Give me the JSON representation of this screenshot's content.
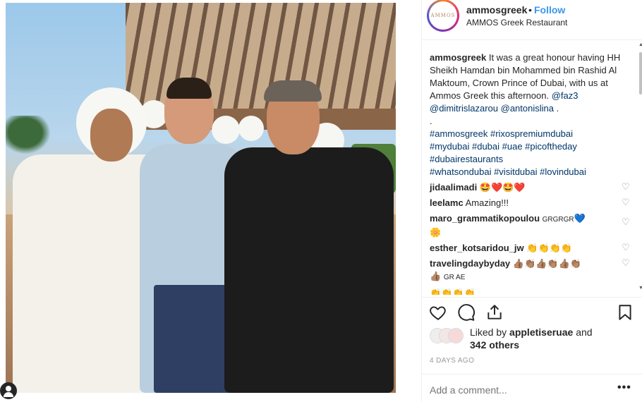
{
  "post": {
    "photo_alt": "Four men posing at a restaurant terrace"
  },
  "header": {
    "username": "ammosgreek",
    "separator": "•",
    "follow_label": "Follow",
    "location": "AMMOS Greek Restaurant",
    "logo_text": "AMMOS"
  },
  "caption": {
    "username": "ammosgreek",
    "text": "It was a great honour having HH Sheikh Hamdan bin Mohammed bin Rashid Al Maktoum, Crown Prince of Dubai, with us at Ammos Greek this afternoon.",
    "mentions": [
      "@faz3",
      "@dimitrislazarou",
      "@antonislina"
    ],
    "mention_end": " .",
    "dot_line": ".",
    "hashtags_line1": "#ammosgreek #rixospremiumdubai",
    "hashtags_line2": "#mydubai #dubai #uae #picoftheday",
    "hashtags_line3": "#dubairestaurants",
    "hashtags_line4": "#whatsondubai #visitdubai #lovindubai"
  },
  "comments": [
    {
      "user": "jidaalimadi",
      "text": "🤩❤️🤩❤️"
    },
    {
      "user": "leelamc",
      "text": "Amazing!!!"
    },
    {
      "user": "maro_grammatikopoulou",
      "text_small": "GRGRGR",
      "text": "💙",
      "line2": "🌼"
    },
    {
      "user": "esther_kotsaridou_jw",
      "text": "👏👏👏👏"
    },
    {
      "user": "travelingdaybyday",
      "text": "👍🏽👏🏽👍🏽👏🏽👍🏽👏🏽",
      "line2": "👍🏽",
      "line2_small": "GR AE"
    },
    {
      "user": "",
      "text": "👏👏👏👏"
    }
  ],
  "actions": {
    "like_icon": "heart-icon",
    "comment_icon": "comment-icon",
    "share_icon": "share-icon",
    "save_icon": "bookmark-icon"
  },
  "likes": {
    "prefix": "Liked by",
    "user": "appletiseruae",
    "middle": "and",
    "others": "342 others"
  },
  "timestamp": "4 DAYS AGO",
  "comment_box": {
    "placeholder": "Add a comment...",
    "more": "•••"
  }
}
